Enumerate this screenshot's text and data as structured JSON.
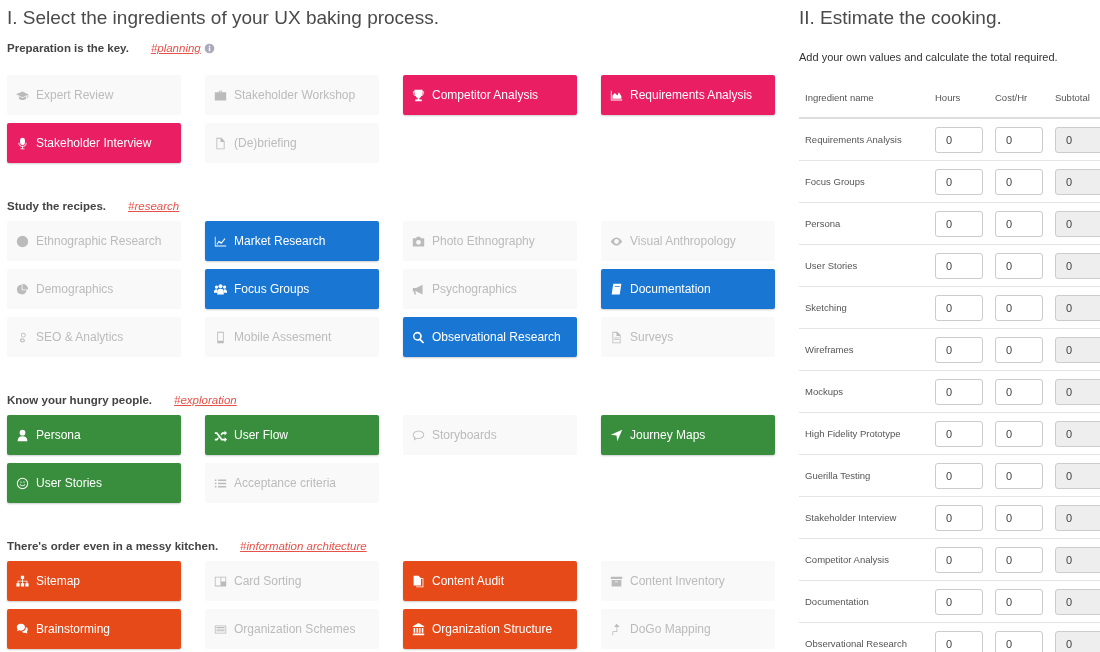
{
  "ingredients": {
    "title": "I. Select the ingredients of your UX baking process.",
    "sections": [
      {
        "heading": "Preparation is the key.",
        "tag": "#planning",
        "info_icon": true,
        "color": "#e91e63",
        "tiles": [
          {
            "label": "Expert Review",
            "selected": false
          },
          {
            "label": "Stakeholder Workshop",
            "selected": false
          },
          {
            "label": "Competitor Analysis",
            "selected": true
          },
          {
            "label": "Requirements Analysis",
            "selected": true
          },
          {
            "label": "Stakeholder Interview",
            "selected": true
          },
          {
            "label": "(De)briefing",
            "selected": false
          }
        ]
      },
      {
        "heading": "Study the recipes.",
        "tag": "#research",
        "info_icon": false,
        "color": "#1976d2",
        "tiles": [
          {
            "label": "Ethnographic Research",
            "selected": false
          },
          {
            "label": "Market Research",
            "selected": true
          },
          {
            "label": "Photo Ethnography",
            "selected": false
          },
          {
            "label": "Visual Anthropology",
            "selected": false
          },
          {
            "label": "Demographics",
            "selected": false
          },
          {
            "label": "Focus Groups",
            "selected": true
          },
          {
            "label": "Psychographics",
            "selected": false
          },
          {
            "label": "Documentation",
            "selected": true
          },
          {
            "label": "SEO & Analytics",
            "selected": false
          },
          {
            "label": "Mobile Assesment",
            "selected": false
          },
          {
            "label": "Observational Research",
            "selected": true
          },
          {
            "label": "Surveys",
            "selected": false
          }
        ]
      },
      {
        "heading": "Know your hungry people.",
        "tag": "#exploration",
        "info_icon": false,
        "color": "#388e3c",
        "tiles": [
          {
            "label": "Persona",
            "selected": true
          },
          {
            "label": "User Flow",
            "selected": true
          },
          {
            "label": "Storyboards",
            "selected": false
          },
          {
            "label": "Journey Maps",
            "selected": true
          },
          {
            "label": "User Stories",
            "selected": true
          },
          {
            "label": "Acceptance criteria",
            "selected": false
          }
        ]
      },
      {
        "heading": "There's order even in a messy kitchen.",
        "tag": "#information architecture",
        "info_icon": false,
        "color": "#e64a19",
        "tiles": [
          {
            "label": "Sitemap",
            "selected": true
          },
          {
            "label": "Card Sorting",
            "selected": false
          },
          {
            "label": "Content Audit",
            "selected": true
          },
          {
            "label": "Content Inventory",
            "selected": false
          },
          {
            "label": "Brainstorming",
            "selected": true
          },
          {
            "label": "Organization Schemes",
            "selected": false
          },
          {
            "label": "Organization Structure",
            "selected": true
          },
          {
            "label": "DoGo Mapping",
            "selected": false
          }
        ]
      }
    ]
  },
  "estimate": {
    "title": "II. Estimate the cooking.",
    "subtitle": "Add your own values and calculate the total required.",
    "columns": [
      "Ingredient name",
      "Hours",
      "Cost/Hr",
      "Subtotal"
    ],
    "rows": [
      {
        "name": "Requirements Analysis",
        "hours": "0",
        "cost": "0",
        "subtotal": "0"
      },
      {
        "name": "Focus Groups",
        "hours": "0",
        "cost": "0",
        "subtotal": "0"
      },
      {
        "name": "Persona",
        "hours": "0",
        "cost": "0",
        "subtotal": "0"
      },
      {
        "name": "User Stories",
        "hours": "0",
        "cost": "0",
        "subtotal": "0"
      },
      {
        "name": "Sketching",
        "hours": "0",
        "cost": "0",
        "subtotal": "0"
      },
      {
        "name": "Wireframes",
        "hours": "0",
        "cost": "0",
        "subtotal": "0"
      },
      {
        "name": "Mockups",
        "hours": "0",
        "cost": "0",
        "subtotal": "0"
      },
      {
        "name": "High Fidelity Prototype",
        "hours": "0",
        "cost": "0",
        "subtotal": "0"
      },
      {
        "name": "Guerilla Testing",
        "hours": "0",
        "cost": "0",
        "subtotal": "0"
      },
      {
        "name": "Stakeholder Interview",
        "hours": "0",
        "cost": "0",
        "subtotal": "0"
      },
      {
        "name": "Competitor Analysis",
        "hours": "0",
        "cost": "0",
        "subtotal": "0"
      },
      {
        "name": "Documentation",
        "hours": "0",
        "cost": "0",
        "subtotal": "0"
      },
      {
        "name": "Observational Research",
        "hours": "0",
        "cost": "0",
        "subtotal": "0"
      }
    ]
  }
}
